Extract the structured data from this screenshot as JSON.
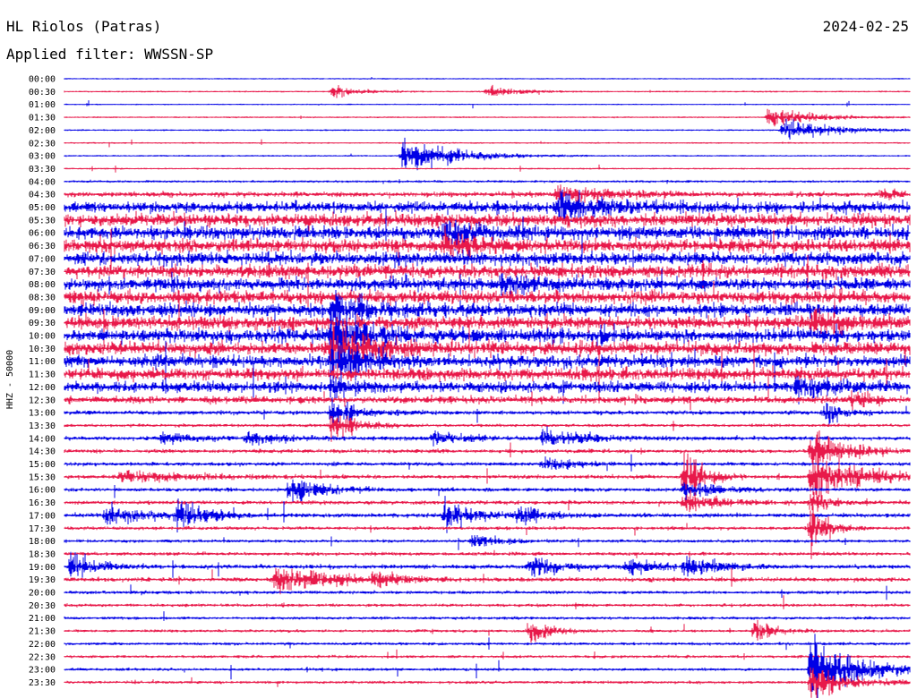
{
  "header": {
    "station": "HL Riolos (Patras)",
    "date": "2024-02-25",
    "filter": "Applied filter: WWSSN-SP"
  },
  "chart_data": {
    "type": "line",
    "title": "HL Riolos (Patras)",
    "ylabel": "HHZ - 50000",
    "tick_labels": [
      "00:00",
      "00:30",
      "01:00",
      "01:30",
      "02:00",
      "02:30",
      "03:00",
      "03:30",
      "04:00",
      "04:30",
      "05:00",
      "05:30",
      "06:00",
      "06:30",
      "07:00",
      "07:30",
      "08:00",
      "08:30",
      "09:00",
      "09:30",
      "10:00",
      "10:30",
      "11:00",
      "11:30",
      "12:00",
      "12:30",
      "13:00",
      "13:30",
      "14:00",
      "14:30",
      "15:00",
      "15:30",
      "16:00",
      "16:30",
      "17:00",
      "17:30",
      "18:00",
      "18:30",
      "19:00",
      "19:30",
      "20:00",
      "20:30",
      "21:00",
      "21:30",
      "22:00",
      "22:30",
      "23:00",
      "23:30"
    ],
    "trace_colors": [
      "#0000e6",
      "#e8194a"
    ],
    "noise_level": [
      0.3,
      0.4,
      0.3,
      0.4,
      0.4,
      0.4,
      0.4,
      0.4,
      0.8,
      2.0,
      4.5,
      5.5,
      5.5,
      5.5,
      5.5,
      5.5,
      5.5,
      5.5,
      5.5,
      5.5,
      5.5,
      5.5,
      5.0,
      5.0,
      4.5,
      3.0,
      1.6,
      1.1,
      1.5,
      1.4,
      1.4,
      1.5,
      1.4,
      1.4,
      1.6,
      1.2,
      1.1,
      1.3,
      1.6,
      1.6,
      1.2,
      1.1,
      1.0,
      1.0,
      1.0,
      1.0,
      1.0,
      1.0
    ],
    "events": [
      {
        "trace": 1,
        "time_min": 9.5,
        "amplitude": 6,
        "duration_min": 1.5
      },
      {
        "trace": 1,
        "time_min": 15,
        "amplitude": 5,
        "duration_min": 2
      },
      {
        "trace": 3,
        "time_min": 25,
        "amplitude": 9,
        "duration_min": 2.5
      },
      {
        "trace": 4,
        "time_min": 25.5,
        "amplitude": 11,
        "duration_min": 3
      },
      {
        "trace": 6,
        "time_min": 12,
        "amplitude": 17,
        "duration_min": 3
      },
      {
        "trace": 9,
        "time_min": 17.5,
        "amplitude": 9,
        "duration_min": 3
      },
      {
        "trace": 9,
        "time_min": 29,
        "amplitude": 5,
        "duration_min": 1
      },
      {
        "trace": 10,
        "time_min": 17.5,
        "amplitude": 14,
        "duration_min": 2.5
      },
      {
        "trace": 12,
        "time_min": 13.5,
        "amplitude": 14,
        "duration_min": 2
      },
      {
        "trace": 13,
        "time_min": 13.5,
        "amplitude": 13,
        "duration_min": 2
      },
      {
        "trace": 16,
        "time_min": 15.5,
        "amplitude": 9,
        "duration_min": 1.5
      },
      {
        "trace": 18,
        "time_min": 9.5,
        "amplitude": 22,
        "duration_min": 2
      },
      {
        "trace": 19,
        "time_min": 26.5,
        "amplitude": 10,
        "duration_min": 2
      },
      {
        "trace": 20,
        "time_min": 9.5,
        "amplitude": 26,
        "duration_min": 2
      },
      {
        "trace": 20,
        "time_min": 19,
        "amplitude": 9,
        "duration_min": 0.8
      },
      {
        "trace": 21,
        "time_min": 9.5,
        "amplitude": 26,
        "duration_min": 2
      },
      {
        "trace": 22,
        "time_min": 9.5,
        "amplitude": 24,
        "duration_min": 1.6
      },
      {
        "trace": 24,
        "time_min": 9.5,
        "amplitude": 10,
        "duration_min": 1
      },
      {
        "trace": 24,
        "time_min": 26,
        "amplitude": 10,
        "duration_min": 2
      },
      {
        "trace": 25,
        "time_min": 28,
        "amplitude": 10,
        "duration_min": 1
      },
      {
        "trace": 26,
        "time_min": 9.5,
        "amplitude": 14,
        "duration_min": 1.5
      },
      {
        "trace": 26,
        "time_min": 27,
        "amplitude": 12,
        "duration_min": 1
      },
      {
        "trace": 27,
        "time_min": 9.5,
        "amplitude": 14,
        "duration_min": 1.5
      },
      {
        "trace": 28,
        "time_min": 3.5,
        "amplitude": 6,
        "duration_min": 2
      },
      {
        "trace": 28,
        "time_min": 6.5,
        "amplitude": 6,
        "duration_min": 2
      },
      {
        "trace": 28,
        "time_min": 13,
        "amplitude": 6,
        "duration_min": 2
      },
      {
        "trace": 28,
        "time_min": 17,
        "amplitude": 9,
        "duration_min": 2.5
      },
      {
        "trace": 29,
        "time_min": 26.5,
        "amplitude": 22,
        "duration_min": 2
      },
      {
        "trace": 30,
        "time_min": 17,
        "amplitude": 8,
        "duration_min": 1.5
      },
      {
        "trace": 31,
        "time_min": 2,
        "amplitude": 6,
        "duration_min": 4
      },
      {
        "trace": 31,
        "time_min": 22,
        "amplitude": 30,
        "duration_min": 1
      },
      {
        "trace": 31,
        "time_min": 26.5,
        "amplitude": 22,
        "duration_min": 3
      },
      {
        "trace": 32,
        "time_min": 8,
        "amplitude": 18,
        "duration_min": 1.5
      },
      {
        "trace": 32,
        "time_min": 22,
        "amplitude": 7,
        "duration_min": 2
      },
      {
        "trace": 33,
        "time_min": 22,
        "amplitude": 10,
        "duration_min": 2
      },
      {
        "trace": 33,
        "time_min": 26.5,
        "amplitude": 12,
        "duration_min": 1
      },
      {
        "trace": 34,
        "time_min": 1.5,
        "amplitude": 10,
        "duration_min": 2
      },
      {
        "trace": 34,
        "time_min": 4,
        "amplitude": 13,
        "duration_min": 2
      },
      {
        "trace": 34,
        "time_min": 13.5,
        "amplitude": 16,
        "duration_min": 1.5
      },
      {
        "trace": 34,
        "time_min": 16,
        "amplitude": 12,
        "duration_min": 1.5
      },
      {
        "trace": 35,
        "time_min": 26.5,
        "amplitude": 26,
        "duration_min": 1
      },
      {
        "trace": 36,
        "time_min": 14.5,
        "amplitude": 6,
        "duration_min": 1.5
      },
      {
        "trace": 38,
        "time_min": 0.2,
        "amplitude": 14,
        "duration_min": 1.5
      },
      {
        "trace": 38,
        "time_min": 16.5,
        "amplitude": 10,
        "duration_min": 2
      },
      {
        "trace": 38,
        "time_min": 20,
        "amplitude": 7,
        "duration_min": 2
      },
      {
        "trace": 38,
        "time_min": 22,
        "amplitude": 10,
        "duration_min": 2
      },
      {
        "trace": 39,
        "time_min": 7.5,
        "amplitude": 14,
        "duration_min": 3
      },
      {
        "trace": 39,
        "time_min": 11,
        "amplitude": 6,
        "duration_min": 1.5
      },
      {
        "trace": 43,
        "time_min": 16.5,
        "amplitude": 12,
        "duration_min": 1.2
      },
      {
        "trace": 43,
        "time_min": 24.5,
        "amplitude": 12,
        "duration_min": 1.2
      },
      {
        "trace": 46,
        "time_min": 26.5,
        "amplitude": 28,
        "duration_min": 3
      },
      {
        "trace": 47,
        "time_min": 26.5,
        "amplitude": 18,
        "duration_min": 2
      }
    ]
  }
}
